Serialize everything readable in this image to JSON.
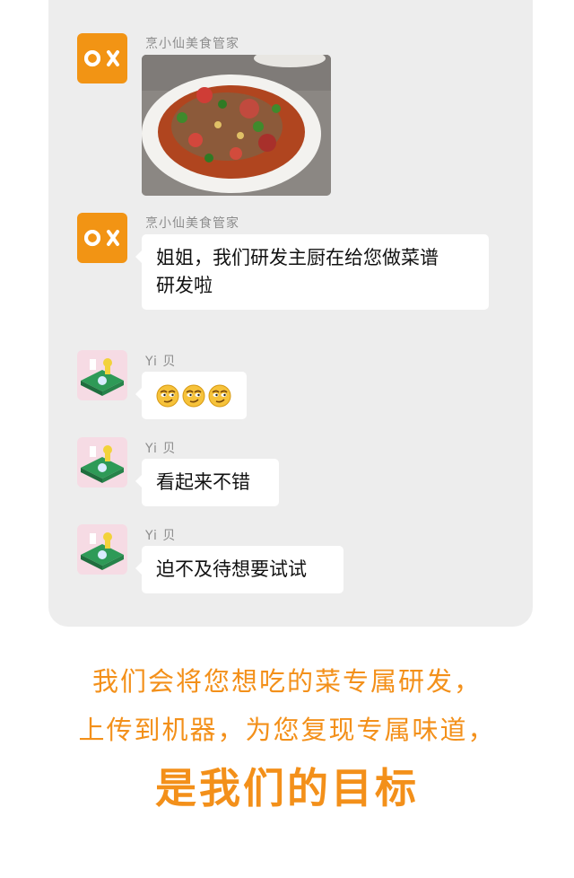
{
  "chat": {
    "messages": [
      {
        "sender": "烹小仙美食管家",
        "type": "image",
        "image_desc": "dish-photo"
      },
      {
        "sender": "烹小仙美食管家",
        "type": "text",
        "lines": [
          "姐姐，我们研发主厨在给您做菜谱",
          "研发啦"
        ]
      },
      {
        "sender": "Yi 贝",
        "type": "emoji",
        "emoji_names": [
          "smirk-face-icon",
          "smirk-face-icon",
          "smirk-face-icon"
        ]
      },
      {
        "sender": "Yi 贝",
        "type": "text",
        "lines": [
          "看起来不错"
        ]
      },
      {
        "sender": "Yi 贝",
        "type": "text",
        "lines": [
          "迫不及待想要试试"
        ]
      }
    ]
  },
  "caption": {
    "line1": "我们会将您想吃的菜专属研发，",
    "line2": "上传到机器，为您复现专属味道，",
    "line3": "是我们的目标"
  },
  "colors": {
    "accent_orange": "#f3901a",
    "bot_avatar": "#f29414",
    "panel_bg": "#ededed"
  }
}
